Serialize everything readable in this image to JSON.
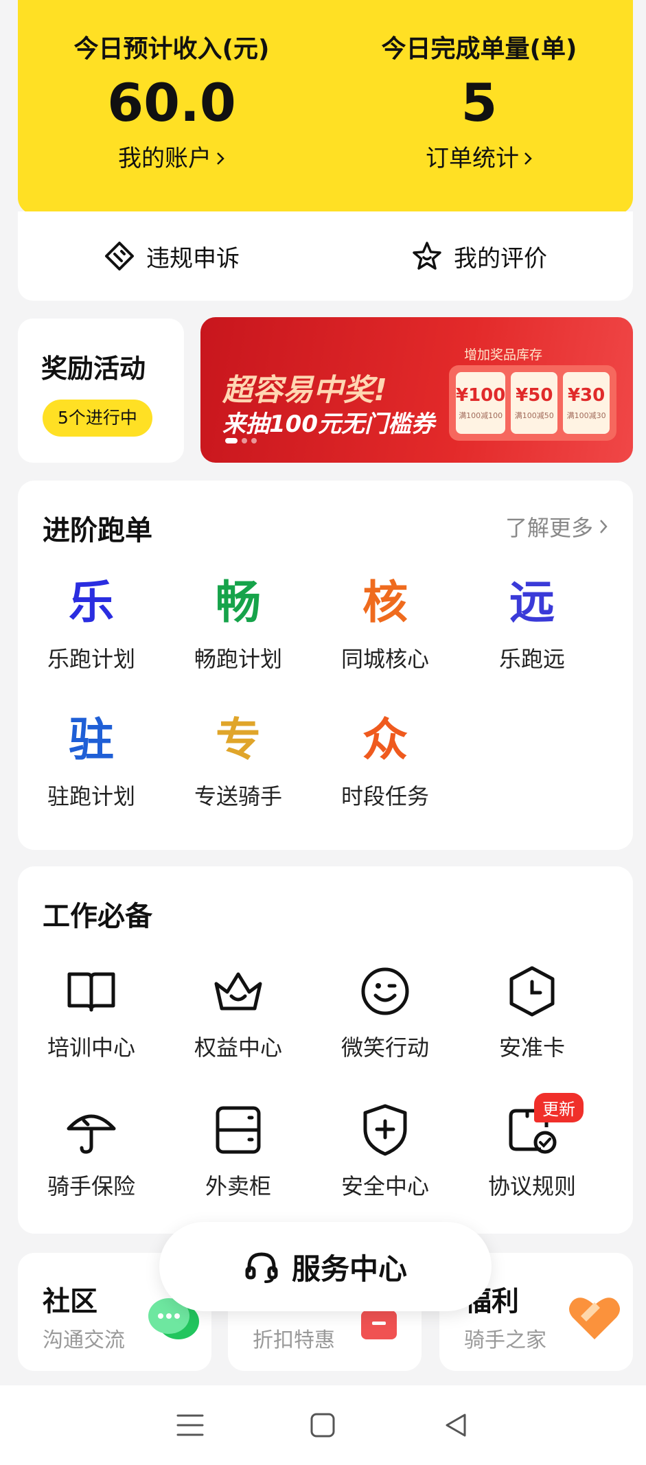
{
  "stats": {
    "left": {
      "label": "今日预计收入(元)",
      "value": "60.0",
      "link": "我的账户"
    },
    "right": {
      "label": "今日完成单量(单)",
      "value": "5",
      "link": "订单统计"
    }
  },
  "quick_links": [
    {
      "label": "违规申诉",
      "icon": "appeal-icon"
    },
    {
      "label": "我的评价",
      "icon": "star-icon"
    }
  ],
  "reward": {
    "title": "奖励活动",
    "status": "5个进行中"
  },
  "banner": {
    "line1": "超容易中奖!",
    "line2": "来抽100元无门槛券",
    "coupon_header": "增加奖品库存",
    "coupons": [
      {
        "value": "¥100",
        "note": "满100减100"
      },
      {
        "value": "¥50",
        "note": "满100减50"
      },
      {
        "value": "¥30",
        "note": "满100减30"
      }
    ]
  },
  "advanced": {
    "title": "进阶跑单",
    "more": "了解更多",
    "items": [
      {
        "glyph": "乐",
        "label": "乐跑计划",
        "color": "#2a2de0"
      },
      {
        "glyph": "畅",
        "label": "畅跑计划",
        "color": "#16a34a"
      },
      {
        "glyph": "核",
        "label": "同城核心",
        "color": "#ef6b1e"
      },
      {
        "glyph": "远",
        "label": "乐跑远",
        "color": "#3a3ad8"
      },
      {
        "glyph": "驻",
        "label": "驻跑计划",
        "color": "#1f5fd6"
      },
      {
        "glyph": "专",
        "label": "专送骑手",
        "color": "#e0a52a"
      },
      {
        "glyph": "众",
        "label": "时段任务",
        "color": "#ef5a1e"
      }
    ]
  },
  "essentials": {
    "title": "工作必备",
    "items": [
      {
        "label": "培训中心",
        "icon": "book-icon"
      },
      {
        "label": "权益中心",
        "icon": "crown-icon"
      },
      {
        "label": "微笑行动",
        "icon": "smile-icon"
      },
      {
        "label": "安准卡",
        "icon": "clock-hex-icon"
      },
      {
        "label": "骑手保险",
        "icon": "umbrella-icon"
      },
      {
        "label": "外卖柜",
        "icon": "locker-icon"
      },
      {
        "label": "安全中心",
        "icon": "shield-plus-icon"
      },
      {
        "label": "协议规则",
        "icon": "agreement-icon",
        "badge": "更新"
      }
    ]
  },
  "bottom_cards": [
    {
      "title": "社区",
      "sub": "沟通交流"
    },
    {
      "title": "",
      "sub": "折扣特惠"
    },
    {
      "title": "福利",
      "sub": "骑手之家"
    }
  ],
  "service": {
    "label": "服务中心"
  }
}
